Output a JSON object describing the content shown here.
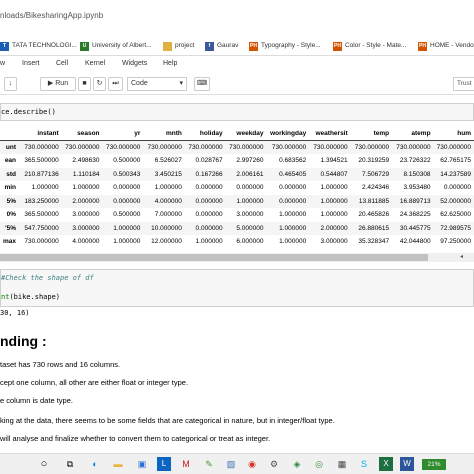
{
  "browser": {
    "url_fragment": "nloads/BikesharingApp.ipynb",
    "bookmarks": [
      {
        "label": "TATA TECHNOLOGI...",
        "icon": "tata-icon",
        "color": "#1a5fb4"
      },
      {
        "label": "University of Albert...",
        "icon": "ualberta-icon",
        "color": "#2a7a2a"
      },
      {
        "label": "project",
        "icon": "folder-icon",
        "color": "#e0b040"
      },
      {
        "label": "Gaurav",
        "icon": "facebook-icon",
        "color": "#3b5998"
      },
      {
        "label": "Typography - Style...",
        "icon": "ph-icon",
        "color": "#d35400"
      },
      {
        "label": "Color - Style - Mate...",
        "icon": "ph-icon",
        "color": "#d35400"
      },
      {
        "label": "HOME - Vendo",
        "icon": "ph-icon",
        "color": "#d35400"
      }
    ]
  },
  "jupyter": {
    "menus": [
      "w",
      "Insert",
      "Cell",
      "Kernel",
      "Widgets",
      "Help"
    ],
    "toolbar": {
      "run_label": "Run",
      "cell_type": "Code",
      "trusted_label": "Trust"
    }
  },
  "cells": {
    "describe_code": "ce.describe()",
    "describe_table": {
      "columns": [
        "instant",
        "season",
        "yr",
        "mnth",
        "holiday",
        "weekday",
        "workingday",
        "weathersit",
        "temp",
        "atemp",
        "hum"
      ],
      "rows": [
        {
          "index": "unt",
          "values": [
            "730.000000",
            "730.000000",
            "730.000000",
            "730.000000",
            "730.000000",
            "730.000000",
            "730.000000",
            "730.000000",
            "730.000000",
            "730.000000",
            "730.000000"
          ]
        },
        {
          "index": "ean",
          "values": [
            "365.500000",
            "2.498630",
            "0.500000",
            "6.526027",
            "0.028767",
            "2.997260",
            "0.683562",
            "1.394521",
            "20.319259",
            "23.726322",
            "62.765175"
          ]
        },
        {
          "index": "std",
          "values": [
            "210.877136",
            "1.110184",
            "0.500343",
            "3.450215",
            "0.167266",
            "2.006161",
            "0.465405",
            "0.544807",
            "7.506729",
            "8.150308",
            "14.237589"
          ]
        },
        {
          "index": "min",
          "values": [
            "1.000000",
            "1.000000",
            "0.000000",
            "1.000000",
            "0.000000",
            "0.000000",
            "0.000000",
            "1.000000",
            "2.424346",
            "3.953480",
            "0.000000"
          ]
        },
        {
          "index": "5%",
          "values": [
            "183.250000",
            "2.000000",
            "0.000000",
            "4.000000",
            "0.000000",
            "1.000000",
            "0.000000",
            "1.000000",
            "13.811885",
            "16.889713",
            "52.000000"
          ]
        },
        {
          "index": "0%",
          "values": [
            "365.500000",
            "3.000000",
            "0.500000",
            "7.000000",
            "0.000000",
            "3.000000",
            "1.000000",
            "1.000000",
            "20.465826",
            "24.368225",
            "62.625000"
          ]
        },
        {
          "index": "'5%",
          "values": [
            "547.750000",
            "3.000000",
            "1.000000",
            "10.000000",
            "0.000000",
            "5.000000",
            "1.000000",
            "2.000000",
            "26.880615",
            "30.445775",
            "72.989575"
          ]
        },
        {
          "index": "max",
          "values": [
            "730.000000",
            "4.000000",
            "1.000000",
            "12.000000",
            "1.000000",
            "6.000000",
            "1.000000",
            "3.000000",
            "35.328347",
            "42.044800",
            "97.250000"
          ]
        }
      ]
    },
    "shape_comment": "Check the shape of df",
    "shape_code_fn": "nt",
    "shape_code_arg": "(bike.shape)",
    "shape_output": "30, 16)"
  },
  "markdown": {
    "heading": "nding :",
    "lines": [
      "taset has 730 rows and 16 columns.",
      "cept one column, all other are either float or integer type.",
      "e column is date type.",
      "king at the data, there seems to be some fields that are categorical in nature, but in integer/float type.",
      " will analyse and finalize whether to convert them to categorical or treat as integer."
    ]
  },
  "taskbar": {
    "icons": [
      "cortana-icon",
      "task-view-icon",
      "edge-icon",
      "file-explorer-icon",
      "store-icon",
      "linkedin-icon",
      "mcafee-icon",
      "app-icon",
      "photos-icon",
      "chrome-icon",
      "settings-icon",
      "maps-icon",
      "app-icon",
      "calculator-icon",
      "skype-icon",
      "excel-icon",
      "word-icon"
    ],
    "battery": "21%"
  }
}
